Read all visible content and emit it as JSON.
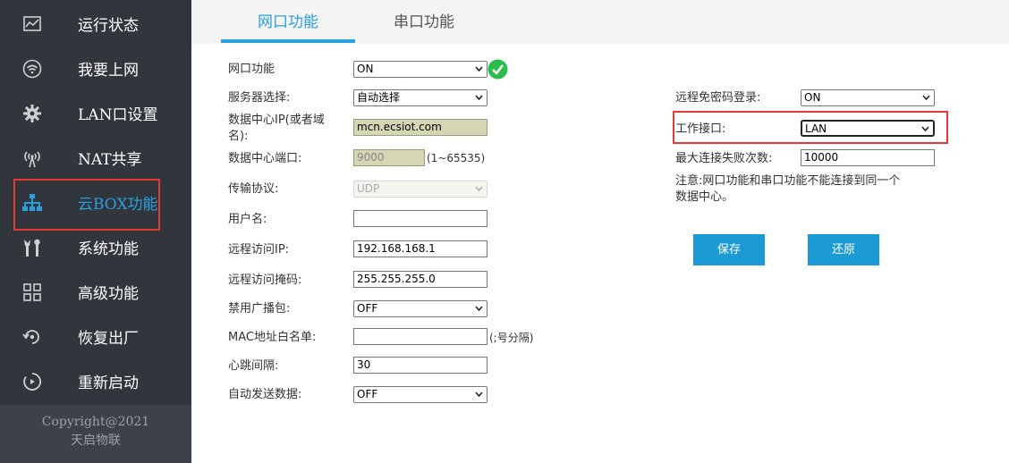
{
  "sidebar": {
    "items": [
      {
        "label": "运行状态",
        "icon": "monitor-chart-icon"
      },
      {
        "label": "我要上网",
        "icon": "wifi-icon"
      },
      {
        "label": "LAN口设置",
        "icon": "gear-icon"
      },
      {
        "label": "NAT共享",
        "icon": "antenna-icon"
      },
      {
        "label": "云BOX功能",
        "icon": "network-tree-icon"
      },
      {
        "label": "系统功能",
        "icon": "tools-icon"
      },
      {
        "label": "高级功能",
        "icon": "grid-apps-icon"
      },
      {
        "label": "恢复出厂",
        "icon": "restore-icon"
      },
      {
        "label": "重新启动",
        "icon": "restart-icon"
      }
    ],
    "active_index": 4,
    "footer": {
      "copyright": "Copyright@2021",
      "brand": "天启物联"
    }
  },
  "tabs": [
    {
      "label": "网口功能",
      "active": true
    },
    {
      "label": "串口功能",
      "active": false
    }
  ],
  "form_left": {
    "net_func": {
      "label": "网口功能",
      "value": "ON"
    },
    "server_select": {
      "label": "服务器选择:",
      "value": "自动选择"
    },
    "dc_ip": {
      "label_line1": "数据中心IP(或者域",
      "label_line2": "名):",
      "value": "mcn.ecsiot.com"
    },
    "dc_port": {
      "label": "数据中心端口:",
      "value": "9000",
      "hint": "(1~65535)"
    },
    "protocol": {
      "label": "传输协议:",
      "value": "UDP"
    },
    "username": {
      "label": "用户名:",
      "value": ""
    },
    "remote_ip": {
      "label": "远程访问IP:",
      "value": "192.168.168.1"
    },
    "remote_mask": {
      "label": "远程访问掩码:",
      "value": "255.255.255.0"
    },
    "disable_broadcast": {
      "label": "禁用广播包:",
      "value": "OFF"
    },
    "mac_whitelist": {
      "label": "MAC地址白名单:",
      "value": "",
      "hint": "(;号分隔)"
    },
    "heartbeat": {
      "label": "心跳间隔:",
      "value": "30"
    },
    "auto_send": {
      "label": "自动发送数据:",
      "value": "OFF"
    }
  },
  "form_right": {
    "remote_nopass": {
      "label": "远程免密码登录:",
      "value": "ON"
    },
    "work_interface": {
      "label": "工作接口:",
      "value": "LAN"
    },
    "max_fail": {
      "label": "最大连接失败次数:",
      "value": "10000"
    },
    "note_line1": "注意:网口功能和串口功能不能连接到同一个",
    "note_line2": "数据中心。"
  },
  "buttons": {
    "save": "保存",
    "restore": "还原"
  },
  "colors": {
    "accent": "#2a9fdd",
    "button": "#1b9ad4",
    "highlight": "#e53935",
    "sidebar": "#31363d",
    "ok": "#2bbd4b"
  }
}
